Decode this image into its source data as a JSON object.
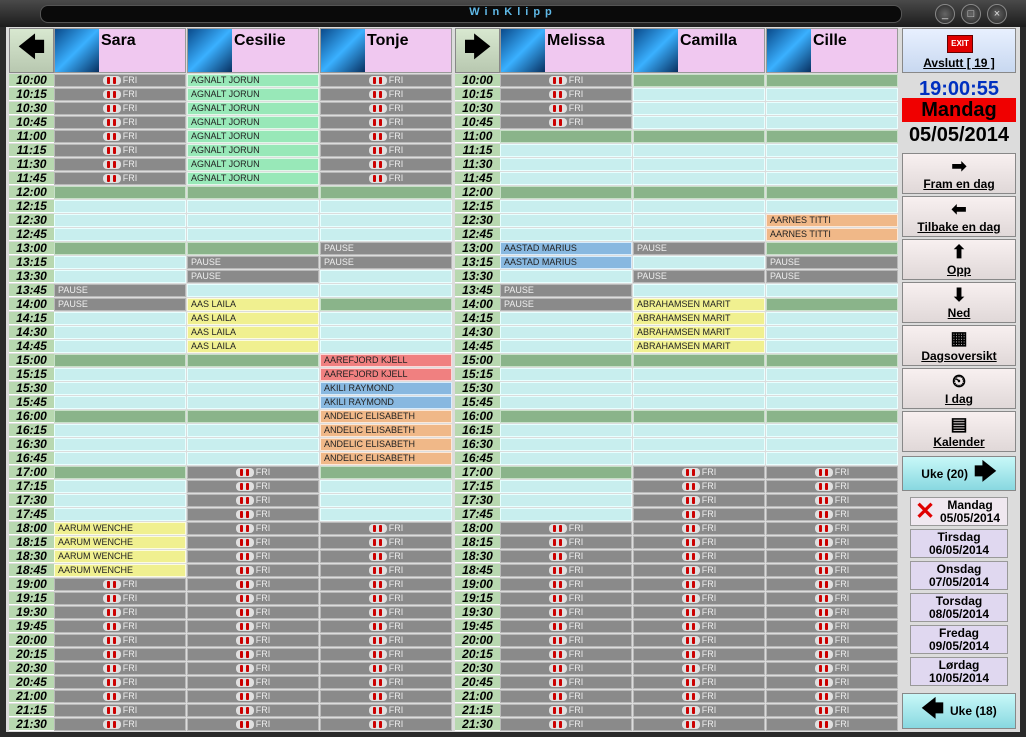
{
  "app": {
    "title": "WinKlipp"
  },
  "nav": {
    "prev_icon": "arrow-left-icon",
    "next_icon": "arrow-right-icon"
  },
  "staff": [
    {
      "name": "Sara"
    },
    {
      "name": "Cesilie"
    },
    {
      "name": "Tonje"
    },
    {
      "name": "Melissa"
    },
    {
      "name": "Camilla"
    },
    {
      "name": "Cille"
    }
  ],
  "times": [
    "10:00",
    "10:15",
    "10:30",
    "10:45",
    "11:00",
    "11:15",
    "11:30",
    "11:45",
    "12:00",
    "12:15",
    "12:30",
    "12:45",
    "13:00",
    "13:15",
    "13:30",
    "13:45",
    "14:00",
    "14:15",
    "14:30",
    "14:45",
    "15:00",
    "15:15",
    "15:30",
    "15:45",
    "16:00",
    "16:15",
    "16:30",
    "16:45",
    "17:00",
    "17:15",
    "17:30",
    "17:45",
    "18:00",
    "18:15",
    "18:30",
    "18:45",
    "19:00",
    "19:15",
    "19:30",
    "19:45",
    "20:00",
    "20:15",
    "20:30",
    "20:45",
    "21:00",
    "21:15",
    "21:30"
  ],
  "fri_label": "FRI",
  "schedule": [
    "FFFFFFFF.......PP...............EEEEFFFFFFFFFFFFFFF",
    "GGGGGGGG.....PP.YYYY........FFFFFFFFFFFFFFFFFFF",
    "FFFFFFFF....PP......RRBBOOOO....FFFFFFFFFFFFFFF",
    "FFFF........bb.PP...............FFFFFFFFFFFFFFF",
    "............P.P.YYYY........FFFFFFFFFFFFFFFFFFF",
    "..........OO.PP.............FFFFFFFFFFFFFFFFFFF"
  ],
  "names": {
    "sara_evening": "AARUM WENCHE",
    "cesilie_morning": "AGNALT JORUN",
    "cesilie_afternoon": "AAS LAILA",
    "tonje_a": "AAREFJORD KJELL",
    "tonje_b": "AKILI RAYMOND",
    "tonje_c": "ANDELIC ELISABETH",
    "melissa_noon": "AASTAD MARIUS",
    "camilla_afternoon": "ABRAHAMSEN MARIT",
    "cille_noon": "AARNES TITTI",
    "pause": "PAUSE"
  },
  "sidebar": {
    "exit_label": "Avslutt [ 19 ]",
    "exit_icon_text": "EXIT",
    "clock": "19:00:55",
    "day": "Mandag",
    "date": "05/05/2014",
    "buttons": [
      {
        "label": "Fram en dag",
        "icon": "arrow-right-icon"
      },
      {
        "label": "Tilbake en dag",
        "icon": "arrow-left-icon"
      },
      {
        "label": "Opp",
        "icon": "arrow-up-icon"
      },
      {
        "label": "Ned",
        "icon": "arrow-down-icon"
      },
      {
        "label": "Dagsoversikt",
        "icon": "day-overview-icon"
      },
      {
        "label": "I dag",
        "icon": "clock-icon"
      },
      {
        "label": "Kalender",
        "icon": "calendar-icon"
      }
    ],
    "week_next": "Uke (20)",
    "week_prev": "Uke (18)",
    "days": [
      {
        "name": "Mandag",
        "date": "05/05/2014"
      },
      {
        "name": "Tirsdag",
        "date": "06/05/2014"
      },
      {
        "name": "Onsdag",
        "date": "07/05/2014"
      },
      {
        "name": "Torsdag",
        "date": "08/05/2014"
      },
      {
        "name": "Fredag",
        "date": "09/05/2014"
      },
      {
        "name": "Lørdag",
        "date": "10/05/2014"
      }
    ]
  },
  "colors": {
    "accent_red": "#f00000",
    "clock_blue": "#0030c0",
    "staff_header": "#f0c8f0"
  }
}
